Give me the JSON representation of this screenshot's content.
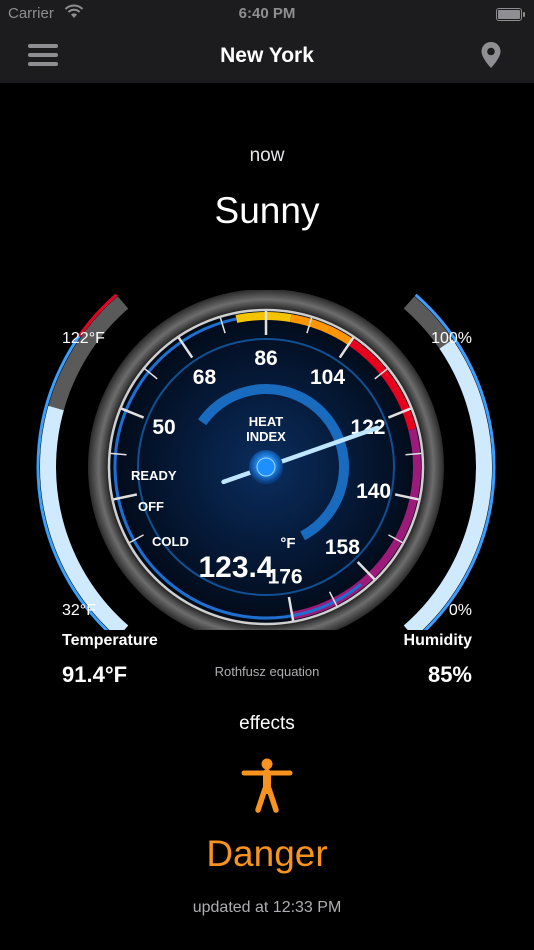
{
  "status": {
    "carrier": "Carrier",
    "time": "6:40 PM"
  },
  "nav": {
    "title": "New York",
    "menu_icon": "hamburger-menu-icon",
    "location_icon": "location-pin-icon"
  },
  "weather": {
    "period": "now",
    "condition": "Sunny"
  },
  "gauge": {
    "title_line1": "HEAT",
    "title_line2": "INDEX",
    "value": "123.4",
    "unit": "°F",
    "scale_labels": [
      "50",
      "68",
      "86",
      "104",
      "122",
      "140",
      "158",
      "176"
    ],
    "zone_labels": [
      "READY",
      "OFF",
      "COLD"
    ],
    "needle_value": 123.4,
    "colors": {
      "yellow": "#f5c400",
      "orange": "#ff9500",
      "red": "#e8001c",
      "purple": "#9c1a7a",
      "blue": "#1e90ff"
    }
  },
  "temperature": {
    "max_label": "122°F",
    "min_label": "32°F",
    "label": "Temperature",
    "value": "91.4°F",
    "fill_fraction": 0.66
  },
  "humidity": {
    "max_label": "100%",
    "min_label": "0%",
    "label": "Humidity",
    "value": "85%",
    "fill_fraction": 0.85
  },
  "equation": "Rothfusz equation",
  "effects": {
    "title": "effects",
    "icon": "person-figure-icon",
    "level": "Danger",
    "level_color": "#f7931e"
  },
  "updated": "updated at 12:33 PM"
}
